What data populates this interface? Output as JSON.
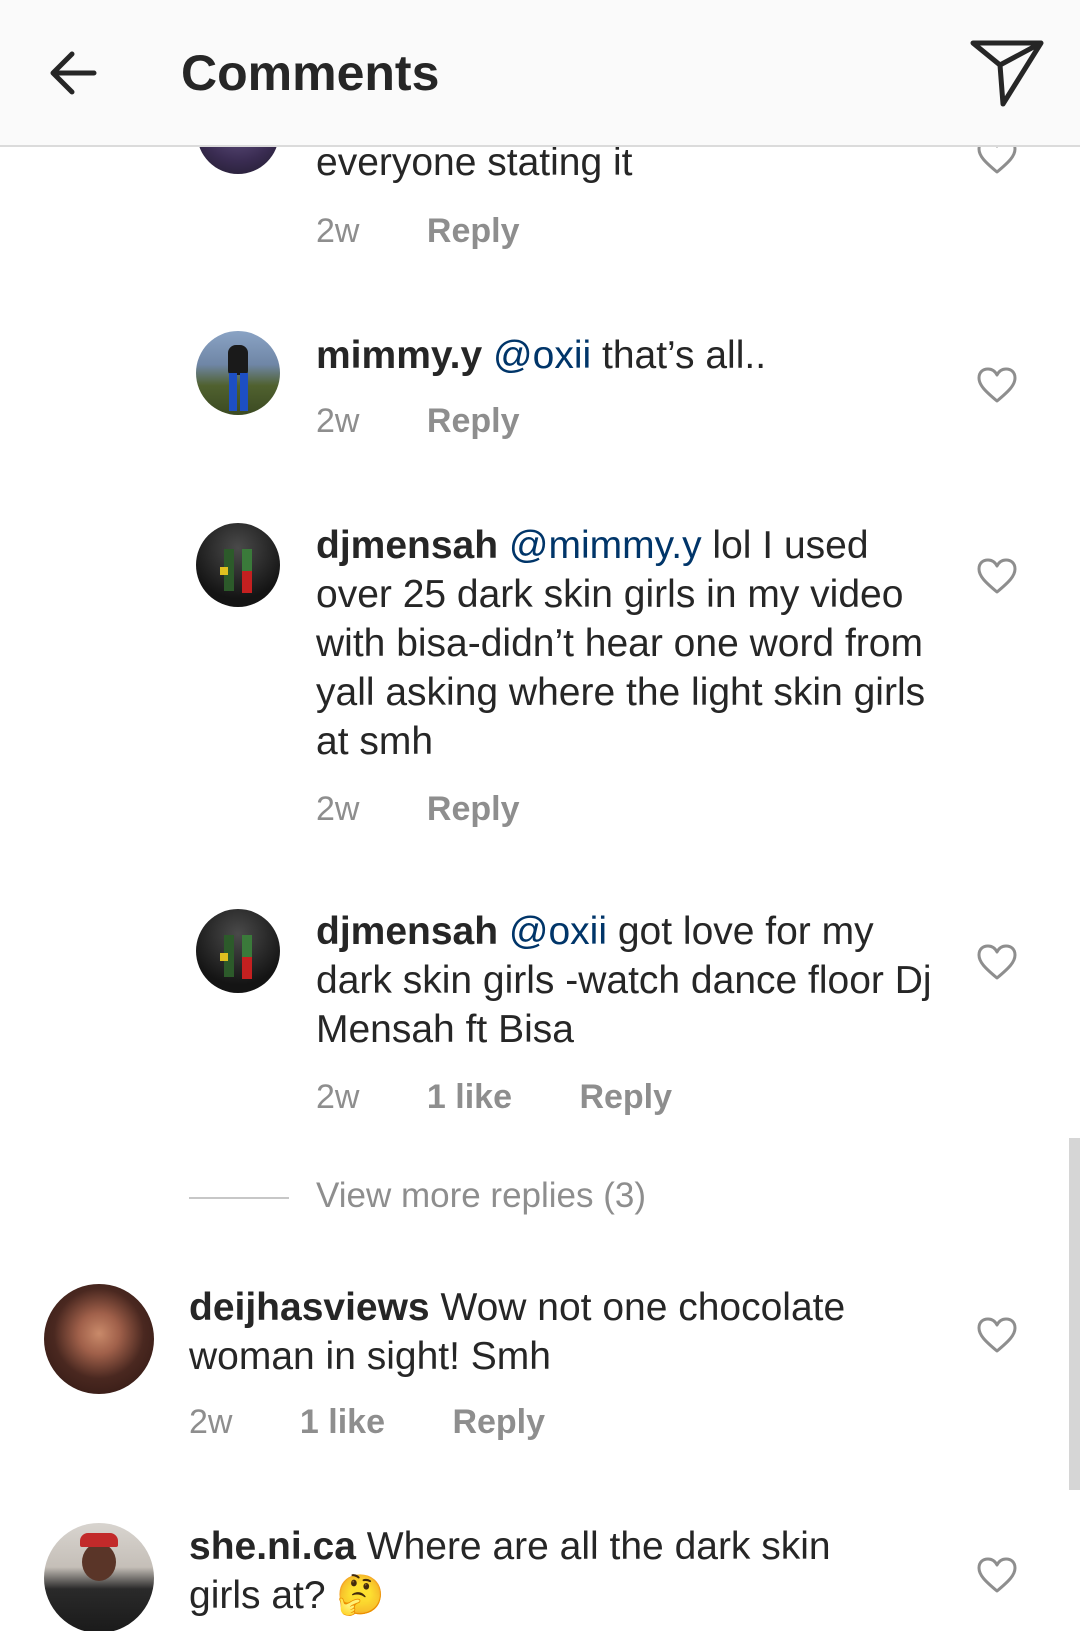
{
  "header": {
    "title": "Comments",
    "back_icon": "arrow-left-icon",
    "send_icon": "paper-plane-icon"
  },
  "comments": [
    {
      "text": "everyone stating it",
      "time": "2w",
      "reply": "Reply"
    },
    {
      "username": "mimmy.y",
      "mention": "@oxii",
      "text": " that’s all..",
      "time": "2w",
      "reply": "Reply"
    },
    {
      "username": "djmensah",
      "mention": "@mimmy.y",
      "text": " lol I used over 25 dark skin girls in my video with bisa-didn’t hear one word from yall asking where the light skin girls at smh",
      "time": "2w",
      "reply": "Reply"
    },
    {
      "username": "djmensah",
      "mention": "@oxii",
      "text": " got love for my dark skin girls -watch dance floor Dj Mensah ft Bisa",
      "time": "2w",
      "likes": "1 like",
      "reply": "Reply"
    },
    {
      "username": "deijhasviews",
      "text": " Wow not one chocolate woman in sight!  Smh",
      "time": "2w",
      "likes": "1 like",
      "reply": "Reply"
    },
    {
      "username": "she.ni.ca",
      "text": " Where are all the dark skin girls at? ",
      "emoji": "🤔"
    }
  ],
  "view_more_replies": "View more replies (3)",
  "colors": {
    "text": "#262626",
    "mention": "#003569",
    "muted": "#8e8e8e",
    "header_bg": "#fafafa"
  }
}
